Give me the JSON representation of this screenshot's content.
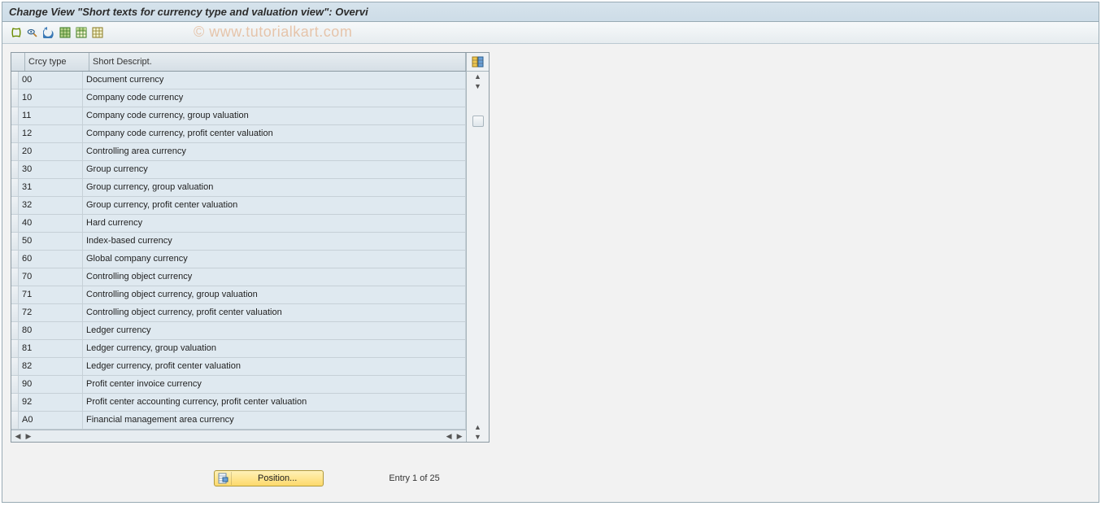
{
  "window": {
    "title": "Change View \"Short texts for currency type and valuation view\": Overvi"
  },
  "watermark": "© www.tutorialkart.com",
  "toolbar": {
    "buttons": [
      "other-view",
      "glasses",
      "undo",
      "select-all",
      "select-block",
      "deselect-all"
    ]
  },
  "table": {
    "headers": {
      "col1": "Crcy type",
      "col2": "Short Descript."
    },
    "rows": [
      {
        "code": "00",
        "desc": "Document currency"
      },
      {
        "code": "10",
        "desc": "Company code currency"
      },
      {
        "code": "11",
        "desc": "Company code currency, group valuation"
      },
      {
        "code": "12",
        "desc": "Company code currency, profit center valuation"
      },
      {
        "code": "20",
        "desc": "Controlling area currency"
      },
      {
        "code": "30",
        "desc": "Group currency"
      },
      {
        "code": "31",
        "desc": "Group currency, group valuation"
      },
      {
        "code": "32",
        "desc": "Group currency, profit center valuation"
      },
      {
        "code": "40",
        "desc": "Hard currency"
      },
      {
        "code": "50",
        "desc": "Index-based currency"
      },
      {
        "code": "60",
        "desc": "Global company currency"
      },
      {
        "code": "70",
        "desc": "Controlling object currency"
      },
      {
        "code": "71",
        "desc": "Controlling object currency, group valuation"
      },
      {
        "code": "72",
        "desc": "Controlling object currency, profit center valuation"
      },
      {
        "code": "80",
        "desc": "Ledger currency"
      },
      {
        "code": "81",
        "desc": "Ledger currency, group valuation"
      },
      {
        "code": "82",
        "desc": "Ledger currency, profit center valuation"
      },
      {
        "code": "90",
        "desc": "Profit center invoice currency"
      },
      {
        "code": "92",
        "desc": "Profit center accounting currency, profit center valuation"
      },
      {
        "code": "A0",
        "desc": "Financial management area currency"
      }
    ]
  },
  "footer": {
    "position_label": "Position...",
    "entry_label": "Entry 1 of 25"
  }
}
